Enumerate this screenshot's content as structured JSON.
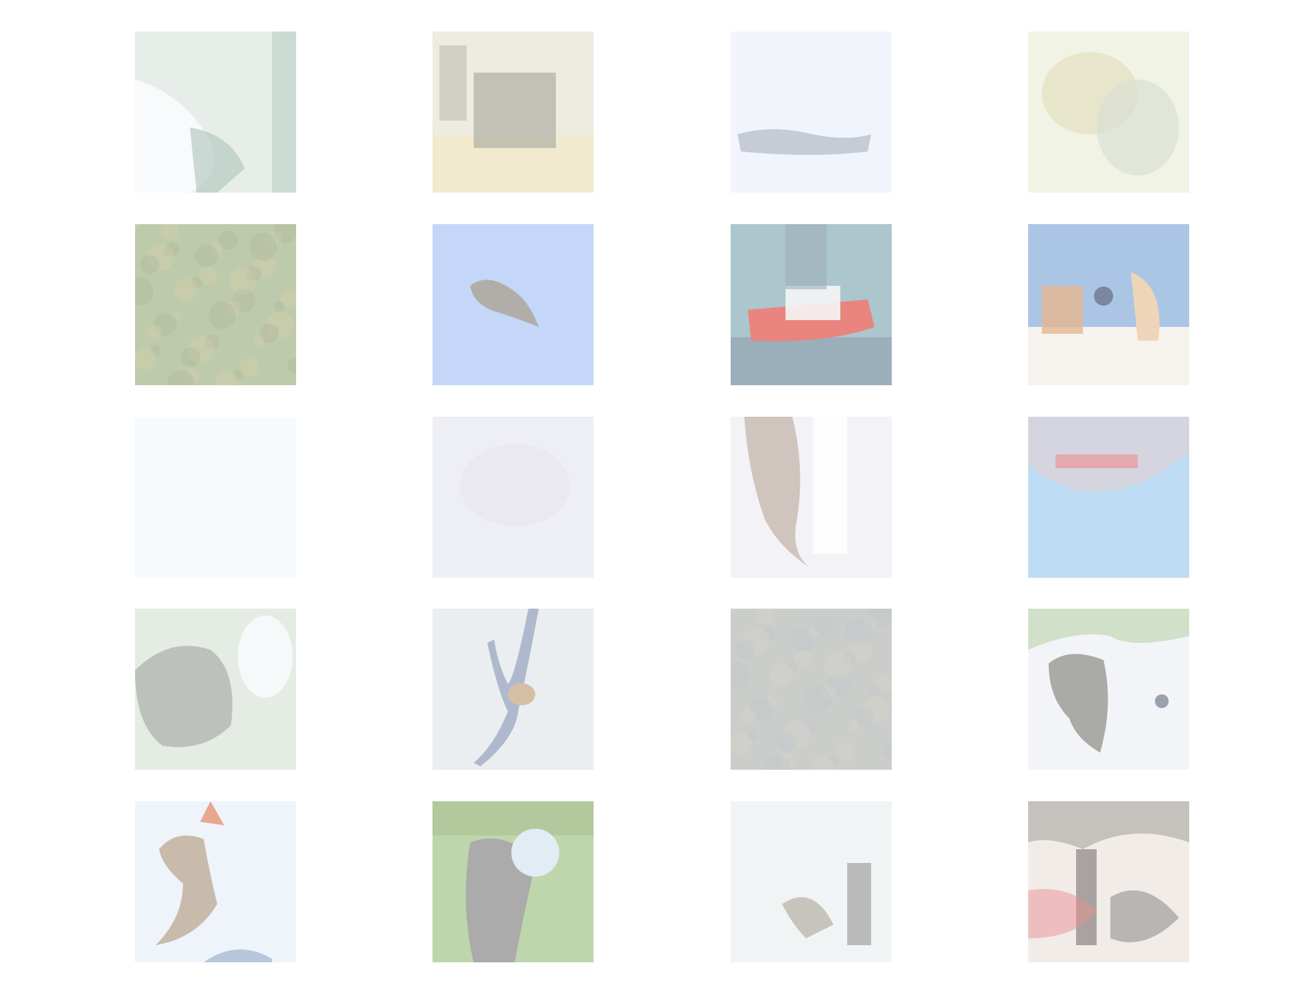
{
  "grid": {
    "rows": 5,
    "cols": 4,
    "tiles": [
      {
        "bg": "#dfe8e3",
        "accent": "#8fb0a0",
        "accent2": "#f6f8fa",
        "shape": "coast"
      },
      {
        "bg": "#e7e6da",
        "accent": "#9a9a8c",
        "accent2": "#ece3bf",
        "shape": "block"
      },
      {
        "bg": "#e6eef7",
        "accent": "#98a4b2",
        "accent2": "#f1f5fb",
        "shape": "streak"
      },
      {
        "bg": "#ecefdc",
        "accent": "#d9cf9a",
        "accent2": "#c9d2c6",
        "shape": "blob"
      },
      {
        "bg": "#a9b891",
        "accent": "#8f9d78",
        "accent2": "#c8c08d",
        "shape": "texture"
      },
      {
        "bg": "#a9c4f5",
        "accent": "#97928c",
        "accent2": "#c5d8f7",
        "shape": "bird"
      },
      {
        "bg": "#8fb3bd",
        "accent": "#e25b55",
        "accent2": "#f2f2f2",
        "shape": "boat"
      },
      {
        "bg": "#8fb2dc",
        "accent": "#dc9f6c",
        "accent2": "#f3efe8",
        "shape": "collage"
      },
      {
        "bg": "#f3f8fb",
        "accent": "#f0f6fa",
        "accent2": "#f7fafc",
        "shape": "blank"
      },
      {
        "bg": "#e8e8f2",
        "accent": "#d7d1d9",
        "accent2": "#f2f2f7",
        "shape": "faint"
      },
      {
        "bg": "#eeeef4",
        "accent": "#b7a79a",
        "accent2": "#ffffff",
        "shape": "column"
      },
      {
        "bg": "#a8d1ef",
        "accent": "#c7c7d4",
        "accent2": "#e26f70",
        "shape": "plane"
      },
      {
        "bg": "#dde6da",
        "accent": "#9a9f98",
        "accent2": "#f3f6f8",
        "shape": "creature"
      },
      {
        "bg": "#e3e8eb",
        "accent": "#7f8fb0",
        "accent2": "#c9a987",
        "shape": "figure"
      },
      {
        "bg": "#b9bdb8",
        "accent": "#a9b1bb",
        "accent2": "#cdc7bd",
        "shape": "texture"
      },
      {
        "bg": "#eef1f4",
        "accent": "#8e8e88",
        "accent2": "#a4c48e",
        "shape": "animal"
      },
      {
        "bg": "#e9f1f7",
        "accent": "#b6a48f",
        "accent2": "#9fb3cf",
        "shape": "leap"
      },
      {
        "bg": "#a9c98f",
        "accent": "#8e8f8e",
        "accent2": "#d7e6f0",
        "shape": "cat"
      },
      {
        "bg": "#ecf0f2",
        "accent": "#b5b0a8",
        "accent2": "#f7f7f7",
        "shape": "wing"
      },
      {
        "bg": "#eee6e2",
        "accent": "#8b8580",
        "accent2": "#e06b6b",
        "shape": "chaos"
      }
    ]
  }
}
